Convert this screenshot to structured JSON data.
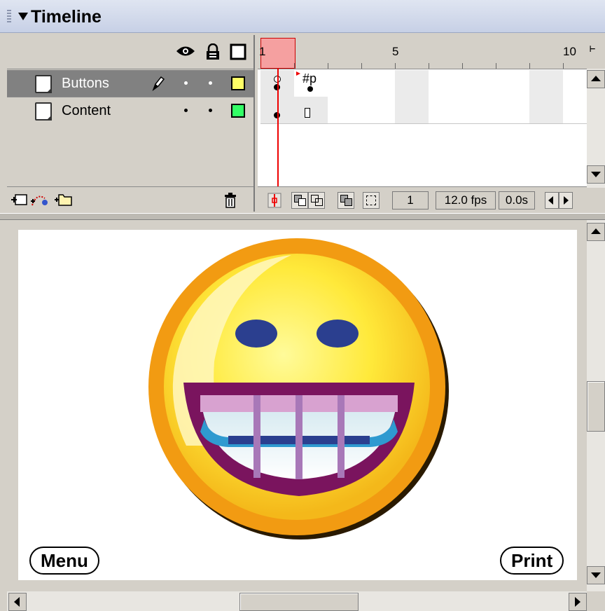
{
  "panel": {
    "title": "Timeline"
  },
  "layers": [
    {
      "name": "Buttons",
      "selected": true,
      "color": "#ffff66"
    },
    {
      "name": "Content",
      "selected": false,
      "color": "#33ff66"
    }
  ],
  "ruler": {
    "labels": [
      "1",
      "5",
      "10"
    ]
  },
  "frames": {
    "buttons_label": "#p",
    "current_frame": "1",
    "frame_rate": "12.0 fps",
    "elapsed_time": "0.0s"
  },
  "stage": {
    "menu_button": "Menu",
    "print_button": "Print"
  },
  "icons": [
    "eye-icon",
    "lock-icon",
    "outline-icon",
    "pencil-icon",
    "insert-layer-icon",
    "motion-guide-icon",
    "add-folder-icon",
    "trash-icon",
    "onion-skin-icon",
    "edit-multiple-frames-icon",
    "center-frame-icon"
  ]
}
